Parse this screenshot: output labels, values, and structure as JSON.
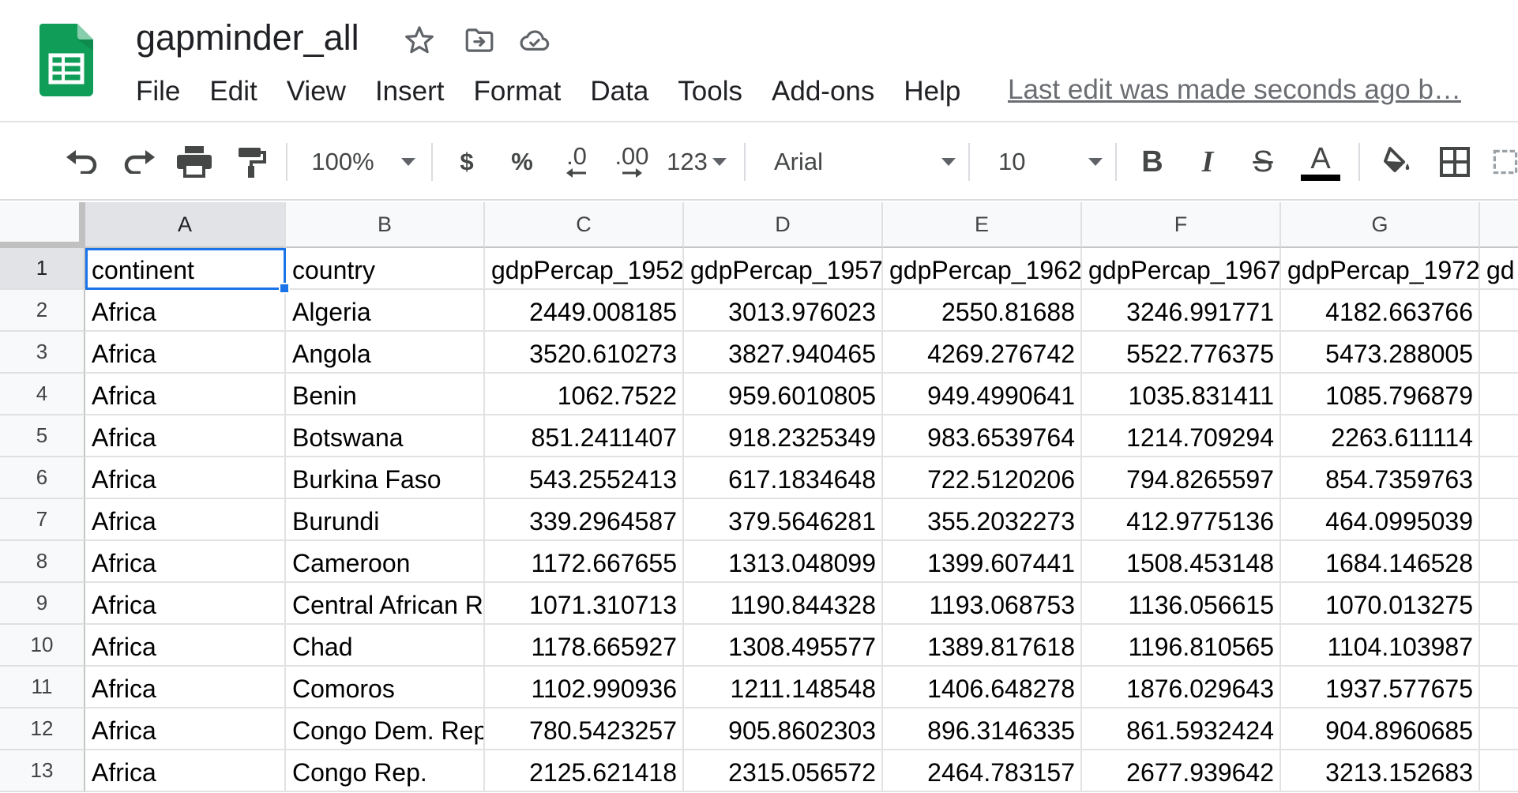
{
  "app": {
    "doc_title": "gapminder_all",
    "logo_icon": "google-sheets-logo",
    "brand_color": "#0f9d58"
  },
  "menu": [
    "File",
    "Edit",
    "View",
    "Insert",
    "Format",
    "Data",
    "Tools",
    "Add-ons",
    "Help"
  ],
  "last_edit": "Last edit was made seconds ago b…",
  "toolbar": {
    "zoom": "100%",
    "currency": "$",
    "percent": "%",
    "decrease_decimal": ".0",
    "increase_decimal": ".00",
    "more_formats": "123",
    "font": "Arial",
    "font_size": "10",
    "bold": "B",
    "italic": "I",
    "strikethrough": "S",
    "text_color": "A"
  },
  "sheet": {
    "columns": [
      "A",
      "B",
      "C",
      "D",
      "E",
      "F",
      "G"
    ],
    "selected_cell": "A1",
    "rows": [
      {
        "n": "1",
        "cells": [
          "continent",
          "country",
          "gdpPercap_1952",
          "gdpPercap_1957",
          "gdpPercap_1962",
          "gdpPercap_1967",
          "gdpPercap_1972",
          "gd"
        ]
      },
      {
        "n": "2",
        "cells": [
          "Africa",
          "Algeria",
          "2449.008185",
          "3013.976023",
          "2550.81688",
          "3246.991771",
          "4182.663766",
          ""
        ]
      },
      {
        "n": "3",
        "cells": [
          "Africa",
          "Angola",
          "3520.610273",
          "3827.940465",
          "4269.276742",
          "5522.776375",
          "5473.288005",
          ""
        ]
      },
      {
        "n": "4",
        "cells": [
          "Africa",
          "Benin",
          "1062.7522",
          "959.6010805",
          "949.4990641",
          "1035.831411",
          "1085.796879",
          ""
        ]
      },
      {
        "n": "5",
        "cells": [
          "Africa",
          "Botswana",
          "851.2411407",
          "918.2325349",
          "983.6539764",
          "1214.709294",
          "2263.611114",
          ""
        ]
      },
      {
        "n": "6",
        "cells": [
          "Africa",
          "Burkina Faso",
          "543.2552413",
          "617.1834648",
          "722.5120206",
          "794.8265597",
          "854.7359763",
          ""
        ]
      },
      {
        "n": "7",
        "cells": [
          "Africa",
          "Burundi",
          "339.2964587",
          "379.5646281",
          "355.2032273",
          "412.9775136",
          "464.0995039",
          ""
        ]
      },
      {
        "n": "8",
        "cells": [
          "Africa",
          "Cameroon",
          "1172.667655",
          "1313.048099",
          "1399.607441",
          "1508.453148",
          "1684.146528",
          ""
        ]
      },
      {
        "n": "9",
        "cells": [
          "Africa",
          "Central African R",
          "1071.310713",
          "1190.844328",
          "1193.068753",
          "1136.056615",
          "1070.013275",
          ""
        ]
      },
      {
        "n": "10",
        "cells": [
          "Africa",
          "Chad",
          "1178.665927",
          "1308.495577",
          "1389.817618",
          "1196.810565",
          "1104.103987",
          ""
        ]
      },
      {
        "n": "11",
        "cells": [
          "Africa",
          "Comoros",
          "1102.990936",
          "1211.148548",
          "1406.648278",
          "1876.029643",
          "1937.577675",
          ""
        ]
      },
      {
        "n": "12",
        "cells": [
          "Africa",
          "Congo Dem. Rep",
          "780.5423257",
          "905.8602303",
          "896.3146335",
          "861.5932424",
          "904.8960685",
          ""
        ]
      },
      {
        "n": "13",
        "cells": [
          "Africa",
          "Congo Rep.",
          "2125.621418",
          "2315.056572",
          "2464.783157",
          "2677.939642",
          "3213.152683",
          ""
        ]
      }
    ]
  }
}
